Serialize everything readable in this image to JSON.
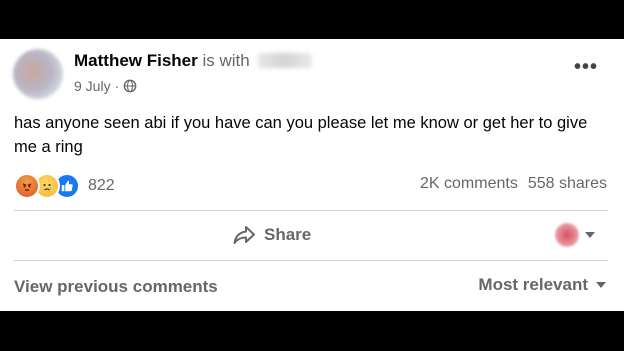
{
  "post": {
    "author": "Matthew Fisher",
    "with_text": "is with",
    "date": "9 July",
    "date_separator": "·",
    "more_label": "•••",
    "text": "has anyone seen abi if you have can you please let me know or get her to give me a ring"
  },
  "reactions": {
    "icons": [
      "angry-reaction-icon",
      "sad-reaction-icon",
      "like-reaction-icon"
    ],
    "count": "822"
  },
  "stats": {
    "comments": "2K comments",
    "shares": "558 shares"
  },
  "actions": {
    "share_label": "Share"
  },
  "comments": {
    "view_previous": "View previous comments",
    "sort_label": "Most relevant"
  },
  "colors": {
    "secondary_text": "#65676b",
    "like_blue": "#1877f2",
    "divider": "#ced0d4"
  }
}
